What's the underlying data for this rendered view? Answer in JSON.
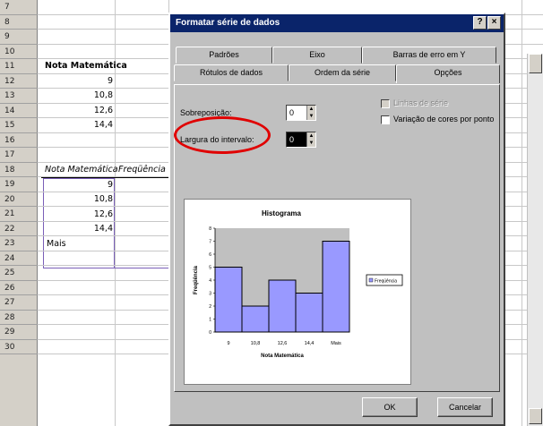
{
  "spreadsheet": {
    "row_numbers": [
      "7",
      "8",
      "9",
      "10",
      "11",
      "12",
      "13",
      "14",
      "15",
      "16",
      "17",
      "18",
      "19",
      "20",
      "21",
      "22",
      "23",
      "24",
      "25",
      "26",
      "27",
      "28",
      "29",
      "30"
    ],
    "table1": {
      "header": "Nota Matemática",
      "values": [
        "9",
        "10,8",
        "12,6",
        "14,4"
      ]
    },
    "table2": {
      "headers": [
        "Nota Matemática",
        "Freqüência"
      ],
      "values": [
        "9",
        "10,8",
        "12,6",
        "14,4"
      ],
      "last_label": "Mais"
    }
  },
  "dialog": {
    "title": "Formatar série de dados",
    "help_button": "?",
    "close_button": "×",
    "tabs_row1": [
      "Padrões",
      "Eixo",
      "Barras de erro em Y"
    ],
    "tabs_row2": [
      "Rótulos de dados",
      "Ordem da série",
      "Opções"
    ],
    "active_tab": "Opções",
    "options": {
      "overlap_label": "Sobreposição:",
      "overlap_value": "0",
      "gap_label": "Largura do intervalo:",
      "gap_value": "0",
      "series_lines_label": "Linhas de série",
      "vary_colors_label": "Variação de cores por ponto"
    },
    "ok_button": "OK",
    "cancel_button": "Cancelar"
  },
  "chart_data": {
    "type": "bar",
    "title": "Histograma",
    "categories": [
      "9",
      "10,8",
      "12,6",
      "14,4",
      "Mais"
    ],
    "values": [
      5,
      2,
      4,
      3,
      7
    ],
    "xlabel": "Nota Matemática",
    "ylabel": "Freqüência",
    "ylim": [
      0,
      8
    ],
    "yticks": [
      "0",
      "1",
      "2",
      "3",
      "4",
      "5",
      "6",
      "7",
      "8"
    ],
    "legend": [
      "Freqüência"
    ],
    "legend_position": "right",
    "colors": {
      "bar": "#9999ff",
      "plot_bg": "#c0c0c0"
    }
  }
}
